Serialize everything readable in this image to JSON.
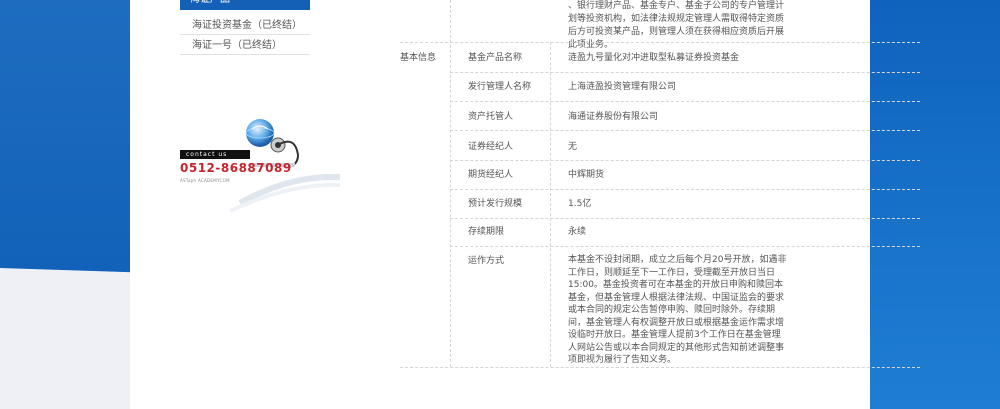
{
  "sidebar": {
    "active_label": "海证产品",
    "items": [
      {
        "label": "海证投资基金（已终结）"
      },
      {
        "label": "海证一号（已终结）"
      }
    ]
  },
  "contact": {
    "tag": "contact us",
    "phone": "0512-86887089",
    "url": "ASTaph ACADEMYCOM"
  },
  "top_text": "、银行理财产品、基金专户、基金子公司的专户管理计划等投资机构，如法律法规规定管理人需取得特定资质后方可投资某产品，则管理人须在获得相应资质后开展此项业务。",
  "section_label": "基本信息",
  "rows": [
    {
      "label": "基金产品名称",
      "value": "涟盈九号量化对冲进取型私募证券投资基金"
    },
    {
      "label": "发行管理人名称",
      "value": "上海涟盈投资管理有限公司"
    },
    {
      "label": "资产托管人",
      "value": "海通证券股份有限公司"
    },
    {
      "label": "证券经纪人",
      "value": "无"
    },
    {
      "label": "期货经纪人",
      "value": "中辉期货"
    },
    {
      "label": "预计发行规模",
      "value": "1.5亿"
    },
    {
      "label": "存续期限",
      "value": "永续"
    },
    {
      "label": "运作方式",
      "value": "本基金不设封闭期，成立之后每个月20号开放，如遇非工作日，则顺延至下一工作日，受理截至开放日当日15:00。基金投资者可在本基金的开放日申购和赎回本基金，但基金管理人根据法律法规、中国证监会的要求或本合同的规定公告暂停申购、赎回时除外。存续期间，基金管理人有权调整开放日或根据基金运作需求增设临时开放日。基金管理人提前3个工作日在基金管理人网站公告或以本合同规定的其他形式告知前述调整事项即视为履行了告知义务。"
    }
  ]
}
